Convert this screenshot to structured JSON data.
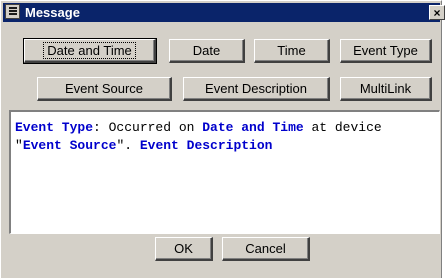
{
  "window": {
    "title": "Message",
    "close_glyph": "×"
  },
  "tokens_row1": [
    "Date and Time",
    "Date",
    "Time",
    "Event Type"
  ],
  "tokens_row2": [
    "Event Source",
    "Event Description",
    "MultiLink"
  ],
  "message": {
    "line1": {
      "kw1": "Event Type",
      "colon": ":",
      "t1": " Occurred on ",
      "kw2": "Date and Time",
      "t2": " at device"
    },
    "line2": {
      "q1": "\"",
      "kw3": "Event Source",
      "q2": "\". ",
      "kw4": "Event Description"
    }
  },
  "footer": {
    "ok": "OK",
    "cancel": "Cancel"
  },
  "colors": {
    "titlebar": "#0a246a",
    "dialog": "#d4d0c8",
    "keyword": "#0000cc"
  },
  "icons": {
    "title": "message-app-icon",
    "close": "close-icon"
  }
}
